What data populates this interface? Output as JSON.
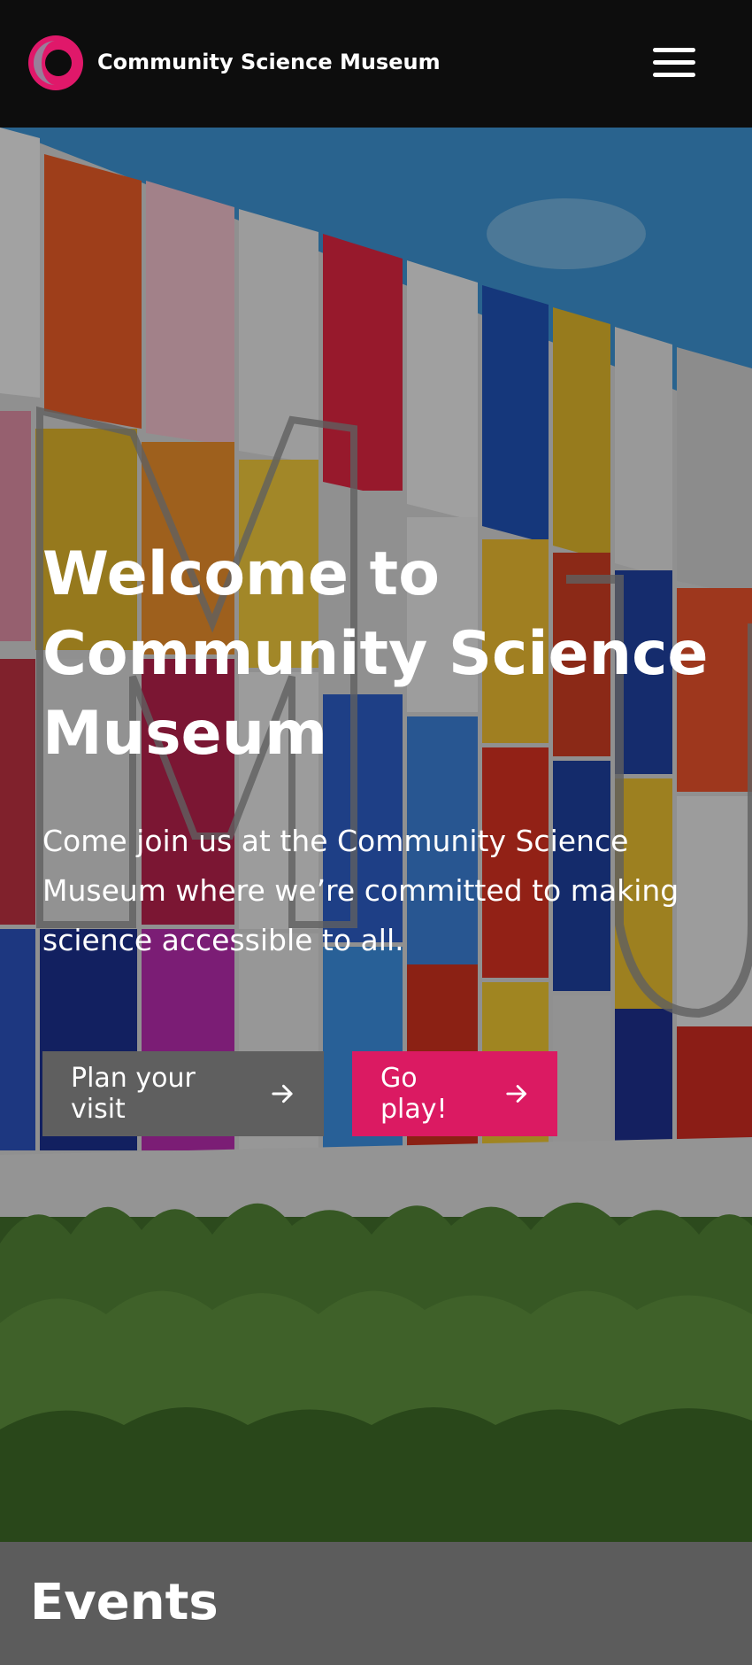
{
  "header": {
    "site_name": "Community Science Museum",
    "logo_icon": "museum-c-logo",
    "menu_icon": "hamburger-menu-icon"
  },
  "hero": {
    "title": "Welcome to Community Science Museum",
    "subtitle": "Come join us at the Community Science Museum where we’re committed to making science accessible to all.",
    "buttons": [
      {
        "label": "Plan your visit",
        "icon": "arrow-right-icon"
      },
      {
        "label": "Go play!",
        "icon": "arrow-right-icon"
      }
    ]
  },
  "events": {
    "title": "Events"
  },
  "colors": {
    "topbar": "#0d0d0d",
    "accent": "#db1a62",
    "secondary_button": "#5f5f5f",
    "events_band": "#5c5c5c"
  }
}
